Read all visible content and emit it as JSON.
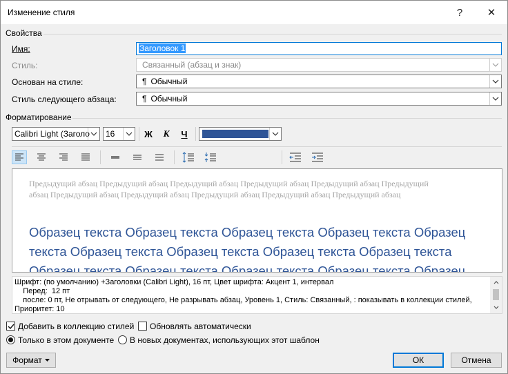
{
  "window": {
    "title": "Изменение стиля",
    "help": "?",
    "close": "✕"
  },
  "properties": {
    "section_label": "Свойства",
    "name_label": "Имя:",
    "name_value": "Заголовок 1",
    "style_label": "Стиль:",
    "style_value": "Связанный (абзац и знак)",
    "based_on_label": "Основан на стиле:",
    "based_on_value": "Обычный",
    "next_style_label": "Стиль следующего абзаца:",
    "next_style_value": "Обычный",
    "pilcrow": "¶"
  },
  "formatting": {
    "section_label": "Форматирование",
    "font": "Calibri Light (Заголо",
    "size": "16",
    "bold": "Ж",
    "italic": "К",
    "underline": "Ч",
    "font_color": "#2f5597"
  },
  "preview": {
    "previous_paragraph": "Предыдущий абзац Предыдущий абзац Предыдущий абзац Предыдущий абзац Предыдущий абзац Предыдущий абзац Предыдущий абзац Предыдущий абзац Предыдущий абзац Предыдущий абзац Предыдущий абзац",
    "sample_text": "Образец текста Образец текста Образец текста Образец текста Образец текста Образец текста Образец текста Образец текста Образец текста Образец текста Образец текста Образец текста Образец текста Образец текста Образец"
  },
  "description": {
    "text": "Шрифт: (по умолчанию) +Заголовки (Calibri Light), 16 пт, Цвет шрифта: Акцент 1, интервал\n    Перед:  12 пт\n    после: 0 пт, Не отрывать от следующего, Не разрывать абзац, Уровень 1, Стиль: Связанный, : показывать в коллекции стилей,\nПриоритет: 10"
  },
  "options": {
    "add_to_gallery": "Добавить в коллекцию стилей",
    "auto_update": "Обновлять автоматически",
    "only_this_doc": "Только в этом документе",
    "new_docs": "В новых документах, использующих этот шаблон"
  },
  "buttons": {
    "format": "Формат",
    "ok": "ОК",
    "cancel": "Отмена"
  }
}
